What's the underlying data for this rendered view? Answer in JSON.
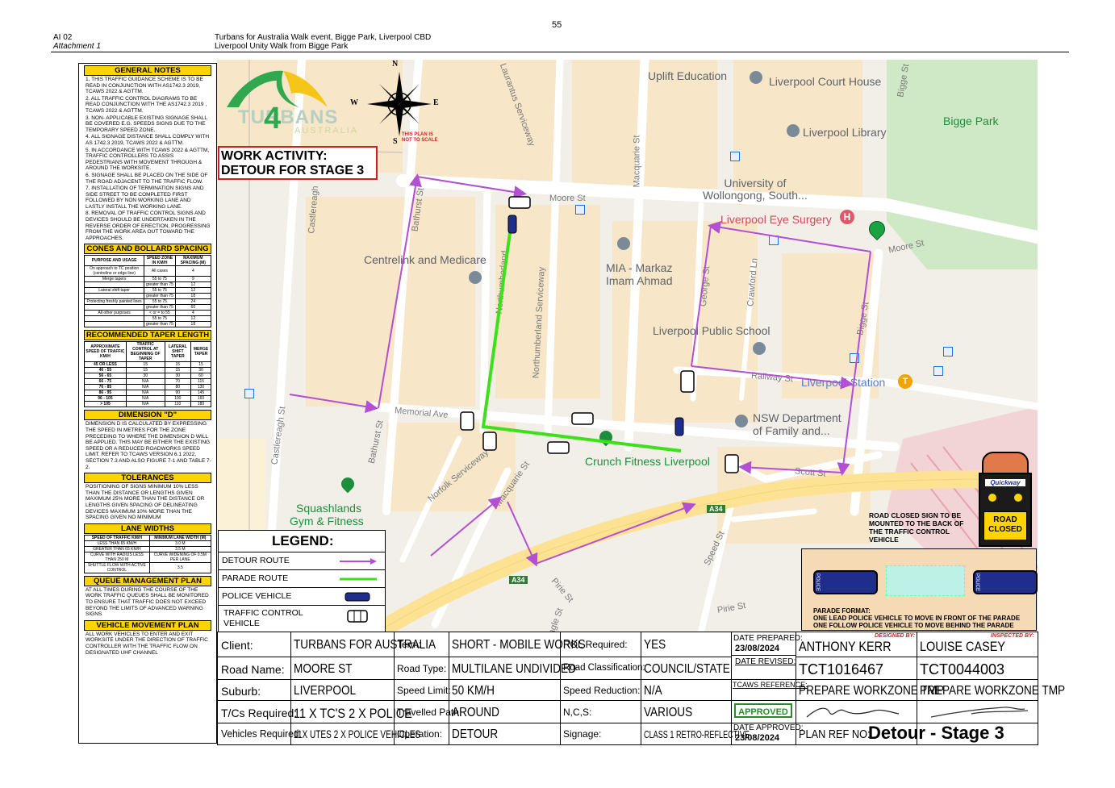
{
  "page": {
    "number": "55",
    "ref_line1": "AI 02",
    "ref_line2": "Attachment 1",
    "title_line1": "Turbans for Australia Walk event, Bigge Park, Liverpool CBD",
    "title_line2": "Liverpool Unity Walk from Bigge Park"
  },
  "sidebar": {
    "general_notes_title": "GENERAL NOTES",
    "general_notes": [
      "1. THIS TRAFFIC GUIDANCE SCHEME IS TO BE READ IN CONJUNCTION WITH AS1742.3 2019, TCAWS 2022 & AGTTM.",
      "2. ALL TRAFFIC CONTROL DIAGRAMS TO BE READ CONJUNCTION WITH THE AS1742.3 2019 , TCAWS 2022 & AGTTM.",
      "3. NON- APPLICABLE EXISTING SIGNAGE SHALL BE COVERED E.G. SPEEDS SIGNS DUE TO THE TEMPORARY SPEED ZONE.",
      "4. ALL SIGNAGE DISTANCE SHALL COMPLY WITH AS 1742.3 2019, TCAWS 2022 & AGTTM.",
      "5. IN ACCORDANCE WITH TCAWS 2022 & AGTTM, TRAFFIC CONTROLLERS TO ASSIS PEDESTRIANS WITH MOVEMENT THROUGH & AROUND THE WORKSITE.",
      "6. SIGNAGE SHALL BE PLACED ON THE SIDE OF THE ROAD ADJACENT TO THE TRAFFIC FLOW.",
      "7. INSTALLATION OF TERMINATION SIGNS AND SIDE STREET TO BE COMPLETED FIRST FOLLOWED BY NON WORKING LANE AND LASTLY INSTALL THE WORKING LANE.",
      "8. REMOVAL OF TRAFFIC CONTROL SIGNS AND DEVICES SHOULD BE UNDERTAKEN IN THE REVERSE ORDER OF ERECTION, PROGRESSING FROM THE WORK AREA OUT TOWARD THE APPROACHES."
    ],
    "cones_title": "CONES AND BOLLARD SPACING",
    "cones_header": [
      "PURPOSE AND USAGE",
      "SPEED ZONE IN KM/H",
      "MAXIMUM SPACING (M)"
    ],
    "cones_rows": [
      [
        "On approach to TC position (centreline or edge line)",
        "All cases",
        "4"
      ],
      [
        "Merge tapers",
        "55 to 75",
        "9"
      ],
      [
        "",
        "greater than 75",
        "12"
      ],
      [
        "Lateral shift taper",
        "55 to 75",
        "12"
      ],
      [
        "",
        "greater than 75",
        "18"
      ],
      [
        "Protecting freshly painted lines",
        "55 to 75",
        "24"
      ],
      [
        "",
        "greater than 75",
        "60"
      ],
      [
        "All other purposes",
        "< or = to 55",
        "4"
      ],
      [
        "",
        "55 to 75",
        "12"
      ],
      [
        "",
        "greater than 75",
        "18"
      ]
    ],
    "taper_title": "RECOMMENDED TAPER LENGTH",
    "taper_header": [
      "APPROXIMATE SPEED OF TRAFFIC KM/H",
      "TRAFFIC CONTROL AT BEGINNING OF TAPER",
      "LATERAL SHIFT TAPER",
      "MERGE TAPER"
    ],
    "taper_rows": [
      [
        "45 OR LESS",
        "15",
        "15",
        "15"
      ],
      [
        "46 - 55",
        "15",
        "15",
        "30"
      ],
      [
        "56 - 65",
        "30",
        "30",
        "60"
      ],
      [
        "66 - 75",
        "N/A",
        "70",
        "115"
      ],
      [
        "76 - 85",
        "N/A",
        "80",
        "130"
      ],
      [
        "86 - 95",
        "N/A",
        "90",
        "145"
      ],
      [
        "96 - 105",
        "N/A",
        "100",
        "160"
      ],
      [
        "> 105",
        "N/A",
        "110",
        "180"
      ]
    ],
    "dimension_title": "DIMENSION \"D\"",
    "dimension_text": "DIMENSION D IS CALCULATED BY EXPRESSING THE SPEED IN METRES FOR THE ZONE PRECEDING TO WHERE THE DIMENSION D WILL BE APPLIED. THIS MAY BE EITHER THE EXISTING SPEED OR A REDUCED ROADWORKS SPEED LIMIT. REFER TO TCAWS VERSION 6.1 2022, SECTION 7.3 AND ALSO FIGURE 7-1 AND TABLE 7-2.",
    "tolerances_title": "TOLERANCES",
    "tolerances_text": "POSITIONING OF SIGNS MINIMUM 10% LESS THAN THE DISTANCE OR LENGTHS GIVEN MAXIMUM 25% MORE THAN THE DISTANCE OR LENGTHS GIVEN SPACING OF DELINEATING DEVICES MAXIMUM 10% MORE THAN THE SPACING GIVEN NO MINIMUM",
    "lane_title": "LANE WIDTHS",
    "lane_header": [
      "SPEED OF TRAFFIC KM/H",
      "MINIMUM LANE WIDTH (M)"
    ],
    "lane_rows": [
      [
        "LESS THAN 65 KM/H",
        "3.0 M"
      ],
      [
        "GREATER THAN 65 KM/H",
        "3.5 M"
      ],
      [
        "CURVE WITH RADIUS LESS THAN 250 M",
        "CURVE WIDENING OF 0.5M PER LANE"
      ],
      [
        "SHUTTLE FLOW WITH ACTIVE CONTROL",
        "3.5"
      ]
    ],
    "queue_title": "QUEUE MANAGEMENT PLAN",
    "queue_text": "AT ALL TIMES DURING THE COURSE OF THE WORK TRAFFIC QUEUES SHALL BE MONITORED TO ENSURE THAT TRAFFIC DOES NOT EXCEED BEYOND THE LIMITS OF ADVANCED WARNING SIGNS",
    "vehicle_title": "VEHICLE MOVEMENT PLAN",
    "vehicle_text": "ALL WORK VEHICLES TO ENTER AND EXIT WORKSITE UNDER THE DIRECTION OF TRAFFIC CONTROLLER WITH THE TRAFFIC FLOW ON DESIGNATED UHF CHANNEL"
  },
  "map": {
    "logo_text1": "TURBANS",
    "logo_text2": "4",
    "logo_text3": "AUSTRALIA",
    "compass": {
      "n": "N",
      "e": "E",
      "w": "W",
      "s": "S",
      "note": "THIS PLAN IS NOT TO SCALE"
    },
    "activity_line1": "WORK ACTIVITY:",
    "activity_line2": "DETOUR FOR STAGE 3",
    "streets": {
      "laurantus": "Laurantus Serviceway",
      "macquarie_top": "Macquarie St",
      "moore": "Moore St",
      "moore_right": "Moore St",
      "bathurst_top": "Bathurst St",
      "castlereagh_top": "Castlereagh",
      "northumberland": "Northumberland",
      "northumberland_sw": "Northumberland Serviceway",
      "george": "George St",
      "crawford": "Crawford Ln",
      "bigge": "Bigge St",
      "bigge_top": "Bigge St",
      "railway": "Railway St",
      "memorial": "Memorial Ave",
      "castlereagh_bottom": "Castlereagh St",
      "bathurst_bottom": "Bathurst St",
      "norfolk": "Norfolk Serviceway",
      "macquarie_bottom": "Macquarie St",
      "scott": "Scott St",
      "speed": "Speed St",
      "pirie_left": "Pirie St",
      "pirie_right": "Pirie St",
      "eagle": "Eagle St",
      "a34_1": "A34",
      "a34_2": "A34"
    },
    "places": {
      "uplift": "Uplift Education",
      "court": "Liverpool Court House",
      "library": "Liverpool Library",
      "bigge_park": "Bigge Park",
      "uow": "University of\nWollongong, South...",
      "eye": "Liverpool Eye Surgery",
      "centrelink": "Centrelink and Medicare",
      "mia1": "MIA - Markaz",
      "mia2": "Imam Ahmad",
      "school": "Liverpool Public School",
      "station": "Liverpool Station",
      "nsw1": "NSW Department",
      "nsw2": "of Family and...",
      "crunch": "Crunch Fitness Liverpool",
      "squash1": "Squashlands",
      "squash2": "Gym & Fitness"
    },
    "road_closed_note": "ROAD CLOSED SIGN TO BE MOUNTED TO THE BACK OF THE TRAFFIC CONTROL VEHICLE",
    "quickway": "Quickway",
    "road_closed_sign1": "ROAD",
    "road_closed_sign2": "CLOSED",
    "parade_format_title": "PARADE FORMAT:",
    "parade_format_line1": "ONE LEAD POLICE VEHICLE TO MOVE IN FRONT OF THE PARADE",
    "parade_format_line2": "ONE FOLLOW POLICE VEHICLE TO MOVE BEHIND THE PARADE",
    "police_label": "POLICE",
    "colors": {
      "detour": "#b34fd3",
      "parade": "#3ee01b",
      "map_bg": "#f2efe8",
      "road": "#ffffff",
      "park": "#cfe9c6",
      "block": "#f7e6c8",
      "sign": "#ffd400"
    }
  },
  "legend": {
    "title": "LEGEND:",
    "items": [
      {
        "label": "DETOUR ROUTE",
        "icon": "purple-arrow-icon"
      },
      {
        "label": "PARADE ROUTE",
        "icon": "green-line-icon"
      },
      {
        "label": "POLICE VEHICLE",
        "icon": "police-car-icon"
      },
      {
        "label": "TRAFFIC CONTROL VEHICLE",
        "icon": "traffic-control-vehicle-icon"
      }
    ]
  },
  "title_block": {
    "client_label": "Client:",
    "client": "TURBANS FOR AUSTRALIA",
    "term_label": "Term:",
    "term": "SHORT - MOBILE WORKS",
    "rol_label": "ROL Required:",
    "rol": "YES",
    "date_prepared_label": "DATE PREPARED:",
    "date_prepared": "23/08/2024",
    "designed_by_label": "DESIGNED BY:",
    "designed_by": "ANTHONY KERR",
    "inspected_by_label": "INSPECTED BY:",
    "inspected_by": "LOUISE CASEY",
    "road_name_label": "Road Name:",
    "road_name": "MOORE ST",
    "road_type_label": "Road Type:",
    "road_type": "MULTILANE UNDIVIDED",
    "road_class_label": "Road Classification:",
    "road_class": "COUNCIL/STATE",
    "date_revised_label": "DATE REVISED:",
    "tct1": "TCT1016467",
    "tct2": "TCT0044003",
    "suburb_label": "Suburb:",
    "suburb": "LIVERPOOL",
    "speed_label": "Speed Limit:",
    "speed": "50 KM/H",
    "speed_red_label": "Speed Reduction:",
    "speed_red": "N/A",
    "tcaws_label": "TCAWS REFERENCE:",
    "prepare1": "PREPARE WORKZONE TMP",
    "prepare2": "PREPARE WORKZONE TMP",
    "tc_label": "T/Cs Required:",
    "tc": "11 X TC'S 2 X POLICE",
    "travelled_label": "Travelled Path:",
    "travelled": "AROUND",
    "ncs_label": "N,C,S:",
    "ncs": "VARIOUS",
    "approved": "APPROVED",
    "veh_label": "Vehicles Required:",
    "veh": "11X UTES 2 X POLICE VEHICLES",
    "operation_label": "Operation:",
    "operation": "DETOUR",
    "signage_label": "Signage:",
    "signage": "CLASS 1 RETRO-REFLECTIVE",
    "date_approved_label": "DATE APPROVED:",
    "date_approved": "23/08/2024",
    "plan_ref_label": "PLAN REF NO:",
    "plan_ref": "Detour - Stage 3"
  }
}
